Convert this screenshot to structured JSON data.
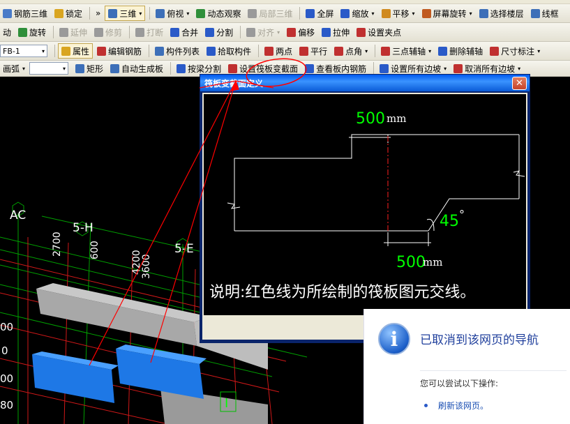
{
  "toolbar1": {
    "items": [
      {
        "label": "钢筋三维",
        "icon": "rebar-3d-icon",
        "color": "#4a7bc8",
        "dropdown": false
      },
      {
        "label": "锁定",
        "icon": "lock-icon",
        "color": "#d9a520",
        "dropdown": false
      },
      {
        "label": "»",
        "icon": "",
        "color": "",
        "dropdown": false
      },
      {
        "label": "三维",
        "icon": "cube-icon",
        "color": "#3d6fb8",
        "dropdown": true,
        "pressed": true
      },
      {
        "label": "俯视",
        "icon": "top-view-icon",
        "color": "#3d6fb8",
        "dropdown": true
      },
      {
        "label": "动态观察",
        "icon": "orbit-icon",
        "color": "#2f8f3a",
        "dropdown": false
      },
      {
        "label": "局部三维",
        "icon": "local-3d-icon",
        "color": "#9a9a9a",
        "dropdown": false,
        "disabled": true
      },
      {
        "label": "全屏",
        "icon": "fullscreen-icon",
        "color": "#2a5ac8",
        "dropdown": false
      },
      {
        "label": "缩放",
        "icon": "zoom-icon",
        "color": "#2a5ac8",
        "dropdown": true
      },
      {
        "label": "平移",
        "icon": "pan-icon",
        "color": "#d08a20",
        "dropdown": true
      },
      {
        "label": "屏幕旋转",
        "icon": "rotate-screen-icon",
        "color": "#c05a20",
        "dropdown": true
      },
      {
        "label": "选择楼层",
        "icon": "floor-select-icon",
        "color": "#3d6fb8",
        "dropdown": false
      },
      {
        "label": "线框",
        "icon": "wireframe-icon",
        "color": "#3d6fb8",
        "dropdown": false
      }
    ]
  },
  "toolbar2": {
    "items": [
      {
        "label": "动",
        "icon": "",
        "color": "",
        "disabled": false
      },
      {
        "label": "旋转",
        "icon": "rotate-icon",
        "color": "#2f8f3a",
        "disabled": false
      },
      {
        "label": "延伸",
        "icon": "extend-icon",
        "color": "#9a9a9a",
        "disabled": true
      },
      {
        "label": "修剪",
        "icon": "trim-icon",
        "color": "#9a9a9a",
        "disabled": true
      },
      {
        "label": "打断",
        "icon": "break-icon",
        "color": "#9a9a9a",
        "disabled": true
      },
      {
        "label": "合并",
        "icon": "merge-icon",
        "color": "#2a5ac8",
        "disabled": false
      },
      {
        "label": "分割",
        "icon": "split-icon",
        "color": "#2a5ac8",
        "disabled": false
      },
      {
        "label": "对齐",
        "icon": "align-icon",
        "color": "#9a9a9a",
        "disabled": true,
        "dropdown": true
      },
      {
        "label": "偏移",
        "icon": "offset-icon",
        "color": "#c03030",
        "disabled": false
      },
      {
        "label": "拉伸",
        "icon": "stretch-icon",
        "color": "#2a5ac8",
        "disabled": false
      },
      {
        "label": "设置夹点",
        "icon": "grip-point-icon",
        "color": "#c03030",
        "disabled": false
      }
    ]
  },
  "toolbar3": {
    "combo_value": "FB-1",
    "items": [
      {
        "label": "属性",
        "icon": "properties-icon",
        "color": "#d9a520",
        "pressed": true
      },
      {
        "label": "编辑钢筋",
        "icon": "edit-rebar-icon",
        "color": "#c03030"
      },
      {
        "label": "构件列表",
        "icon": "component-list-icon",
        "color": "#3d6fb8"
      },
      {
        "label": "拾取构件",
        "icon": "pick-component-icon",
        "color": "#2a5ac8"
      },
      {
        "label": "两点",
        "icon": "two-point-icon",
        "color": "#c03030"
      },
      {
        "label": "平行",
        "icon": "parallel-icon",
        "color": "#c03030"
      },
      {
        "label": "点角",
        "icon": "point-angle-icon",
        "color": "#c03030",
        "dropdown": true
      },
      {
        "label": "三点辅轴",
        "icon": "three-point-axis-icon",
        "color": "#c03030",
        "dropdown": true
      },
      {
        "label": "删除辅轴",
        "icon": "delete-axis-icon",
        "color": "#2a5ac8"
      },
      {
        "label": "尺寸标注",
        "icon": "dimension-icon",
        "color": "#c03030",
        "dropdown": true
      }
    ]
  },
  "toolbar4": {
    "items": [
      {
        "label": "画弧",
        "icon": "",
        "color": "",
        "dropdown": true,
        "kind": "text"
      },
      {
        "label": "",
        "icon": "",
        "color": "",
        "kind": "combo"
      },
      {
        "label": "矩形",
        "icon": "rectangle-icon",
        "color": "#3d6fb8"
      },
      {
        "label": "自动生成板",
        "icon": "auto-slab-icon",
        "color": "#3d6fb8"
      },
      {
        "label": "按梁分割",
        "icon": "split-by-beam-icon",
        "color": "#2a5ac8"
      },
      {
        "label": "设置筏板变截面",
        "icon": "raft-section-icon",
        "color": "#c03030"
      },
      {
        "label": "查看板内钢筋",
        "icon": "view-rebar-icon",
        "color": "#2a5ac8"
      },
      {
        "label": "设置所有边坡",
        "icon": "set-slope-icon",
        "color": "#2a5ac8",
        "dropdown": true
      },
      {
        "label": "取消所有边坡",
        "icon": "cancel-slope-icon",
        "color": "#c03030",
        "dropdown": true
      }
    ]
  },
  "scene": {
    "axis_labels": [
      "AC",
      "5-H",
      "5-E"
    ],
    "dim_labels": [
      "2700",
      "600",
      "4200",
      "3600"
    ],
    "left_numbers": [
      "00",
      "0",
      "00",
      "80"
    ],
    "marker_label": "I"
  },
  "dialog": {
    "title": "筏板变截面定义",
    "dim_top_value": "500",
    "dim_top_unit": "mm",
    "dim_bottom_value": "500",
    "dim_bottom_unit": "mm",
    "angle_value": "45",
    "angle_unit": "°",
    "note": "说明:红色线为所绘制的筏板图元交线。",
    "close_label": "✕"
  },
  "ie_error": {
    "title": "已取消到该网页的导航",
    "subtitle": "您可以尝试以下操作:",
    "link": "刷新该网页。"
  },
  "colors": {
    "annotation_red": "#ff0000",
    "dim_green": "#00ff00",
    "slab_blue": "#1e78e6",
    "grid_green": "#00a000",
    "grid_red": "#d01818"
  }
}
